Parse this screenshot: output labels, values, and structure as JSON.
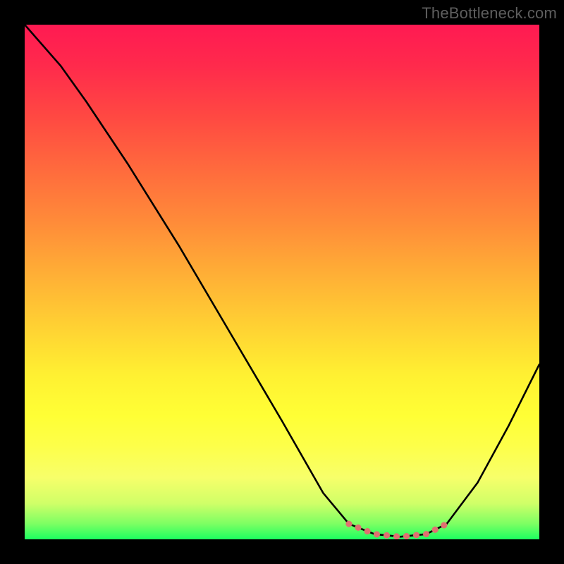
{
  "watermark": "TheBottleneck.com",
  "chart_data": {
    "type": "line",
    "title": "",
    "xlabel": "",
    "ylabel": "",
    "x_range": [
      0,
      100
    ],
    "y_range": [
      0,
      100
    ],
    "grid": false,
    "legend": false,
    "background_gradient": {
      "direction": "vertical",
      "stops": [
        {
          "pos": 0.0,
          "color": "#ff1a52"
        },
        {
          "pos": 0.08,
          "color": "#ff2a4c"
        },
        {
          "pos": 0.18,
          "color": "#ff4942"
        },
        {
          "pos": 0.28,
          "color": "#ff6a3d"
        },
        {
          "pos": 0.38,
          "color": "#ff8a39"
        },
        {
          "pos": 0.48,
          "color": "#ffad36"
        },
        {
          "pos": 0.58,
          "color": "#ffcf33"
        },
        {
          "pos": 0.68,
          "color": "#fff032"
        },
        {
          "pos": 0.76,
          "color": "#ffff35"
        },
        {
          "pos": 0.82,
          "color": "#fdff4a"
        },
        {
          "pos": 0.88,
          "color": "#f7ff6a"
        },
        {
          "pos": 0.93,
          "color": "#d0ff68"
        },
        {
          "pos": 0.97,
          "color": "#7cff63"
        },
        {
          "pos": 1.0,
          "color": "#1cff60"
        }
      ]
    },
    "series": [
      {
        "name": "bottleneck-curve",
        "color": "#000000",
        "points": [
          {
            "x": 0,
            "y": 100
          },
          {
            "x": 7,
            "y": 92
          },
          {
            "x": 12,
            "y": 85
          },
          {
            "x": 20,
            "y": 73
          },
          {
            "x": 30,
            "y": 57
          },
          {
            "x": 40,
            "y": 40
          },
          {
            "x": 50,
            "y": 23
          },
          {
            "x": 58,
            "y": 9
          },
          {
            "x": 63,
            "y": 3
          },
          {
            "x": 68,
            "y": 1
          },
          {
            "x": 73,
            "y": 0.5
          },
          {
            "x": 78,
            "y": 1
          },
          {
            "x": 82,
            "y": 3
          },
          {
            "x": 88,
            "y": 11
          },
          {
            "x": 94,
            "y": 22
          },
          {
            "x": 100,
            "y": 34
          }
        ]
      },
      {
        "name": "optimal-zone-highlight",
        "color": "#e07070",
        "stroke_width_px": 9,
        "stroke_linecap": "round",
        "points": [
          {
            "x": 63,
            "y": 3
          },
          {
            "x": 68,
            "y": 1
          },
          {
            "x": 73,
            "y": 0.5
          },
          {
            "x": 78,
            "y": 1
          },
          {
            "x": 82,
            "y": 3
          }
        ]
      }
    ]
  }
}
